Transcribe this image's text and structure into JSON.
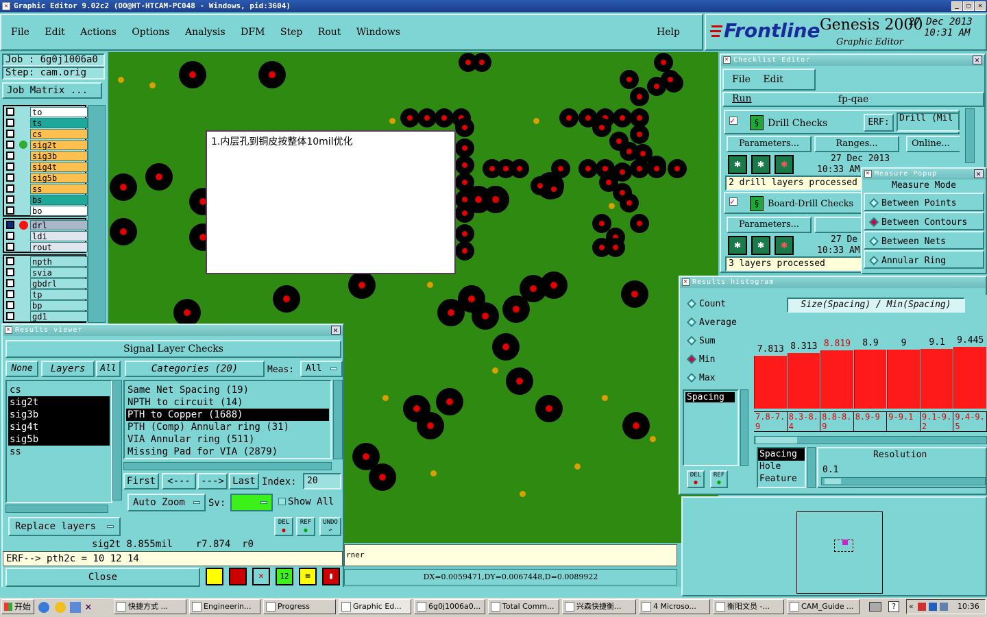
{
  "window": {
    "title": "Graphic Editor 9.02c2 (OO@HT-HTCAM-PC048 - Windows, pid:3604)"
  },
  "menu": [
    "File",
    "Edit",
    "Actions",
    "Options",
    "Analysis",
    "DFM",
    "Step",
    "Rout",
    "Windows"
  ],
  "help": "Help",
  "brand": {
    "logo": "Frontline",
    "product": "Genesis 2000",
    "subtitle": "Graphic Editor",
    "date": "27 Dec 2013",
    "time": "10:31 AM"
  },
  "job": {
    "job": "Job : 6g0j1006a0",
    "step": "Step: cam.orig",
    "matrix": "Job Matrix ..."
  },
  "layers_group1": [
    {
      "name": "to",
      "color": "#ffffff"
    },
    {
      "name": "ts",
      "color": "#1ea89a"
    },
    {
      "name": "cs",
      "color": "#ffc050"
    },
    {
      "name": "sig2t",
      "color": "#ffc050"
    },
    {
      "name": "sig3b",
      "color": "#ffc050"
    },
    {
      "name": "sig4t",
      "color": "#ffc050"
    },
    {
      "name": "sig5b",
      "color": "#ffc050"
    },
    {
      "name": "ss",
      "color": "#ffc050"
    },
    {
      "name": "bs",
      "color": "#1ea89a"
    },
    {
      "name": "bo",
      "color": "#ffffff"
    }
  ],
  "layers_group2": [
    {
      "name": "drl",
      "color": "#a8b8c8"
    },
    {
      "name": "ldi",
      "color": "#dfe6ee"
    },
    {
      "name": "rout",
      "color": "#dfe6ee"
    }
  ],
  "layers_group3": [
    {
      "name": "npth"
    },
    {
      "name": "svia"
    },
    {
      "name": "gbdrl"
    },
    {
      "name": "tp"
    },
    {
      "name": "bp"
    },
    {
      "name": "gd1"
    }
  ],
  "note": "1.内层孔到铜皮按整体10mil优化",
  "checklist": {
    "title": "Checklist Editor",
    "menu": [
      "File",
      "Edit",
      "Run"
    ],
    "name": "fp-qae",
    "drill_checks": "Drill Checks",
    "erf_label": "ERF:",
    "erf_value": "Drill (Mil",
    "parameters": "Parameters...",
    "ranges": "Ranges...",
    "online": "Online...",
    "drill_date": "27 Dec 2013",
    "drill_time": "10:33 AM",
    "drill_status": "2 drill layers processed",
    "board_checks": "Board-Drill Checks",
    "ranges2": "Rang",
    "board_date": "27 De",
    "board_time": "10:33 AM",
    "board_status": "3 layers processed"
  },
  "measure": {
    "title": "Measure Popup",
    "mode": "Measure Mode",
    "options": [
      "Between Points",
      "Between Contours",
      "Between Nets",
      "Annular Ring"
    ],
    "selected": 1
  },
  "results_viewer": {
    "title": "Results viewer",
    "header": "Signal Layer Checks",
    "none": "None",
    "layers": "Layers",
    "all": "All",
    "categories": "Categories (20)",
    "meas_label": "Meas:",
    "meas_value": "All",
    "layer_list": [
      "cs",
      "sig2t",
      "sig3b",
      "sig4t",
      "sig5b",
      "ss"
    ],
    "category_list": [
      "Same Net Spacing (19)",
      "NPTH to circuit (14)",
      "PTH to Copper (1688)",
      "PTH (Comp) Annular ring (31)",
      "VIA Annular ring (511)",
      "Missing Pad for VIA (2879)"
    ],
    "first": "First",
    "prev": "<---",
    "next": "--->",
    "last": "Last",
    "index_label": "Index:",
    "index_value": "20",
    "auto_zoom": "Auto Zoom",
    "sv_label": "Sv:",
    "show_all": "Show All",
    "replace_layers": "Replace layers",
    "del": "DEL",
    "ref": "REF",
    "undo": "UNDO"
  },
  "status": {
    "line1": "sig2t 8.855mil    r7.874  r0",
    "line2": "ERF--> pth2c = 10 12 14",
    "close": "Close",
    "corner": "rner",
    "dx": "DX=0.0059471,DY=0.0067448,D=0.0089922"
  },
  "histogram": {
    "title": "Results histogram",
    "modes": [
      "Count",
      "Average",
      "Sum",
      "Min",
      "Max"
    ],
    "selected_mode": 3,
    "list_item": "Spacing",
    "chart_title": "Size(Spacing) / Min(Spacing)",
    "tags": [
      "Spacing",
      "Hole",
      "Feature"
    ],
    "resolution_label": "Resolution",
    "resolution_value": "0.1",
    "del": "DEL",
    "ref": "REF"
  },
  "chart_data": {
    "type": "bar",
    "title": "Size(Spacing) / Min(Spacing)",
    "categories": [
      "7.8-7.9",
      "8.3-8.4",
      "8.8-8.9",
      "8.9-9",
      "9-9.1",
      "9.1-9.2",
      "9.4-9.5"
    ],
    "values": [
      7.813,
      8.313,
      8.819,
      8.9,
      9,
      9.1,
      9.445
    ],
    "value_labels": [
      "7.813",
      "8.313",
      "8.819",
      "8.9",
      "9",
      "9.1",
      "9.445"
    ],
    "highlight_index": 2,
    "bar_color": "#ff1a1a"
  },
  "taskbar": {
    "start": "开始",
    "items": [
      "快捷方式 ...",
      "Engineerin...",
      "Progress",
      "Graphic Ed...",
      "6g0j1006a0...",
      "Total Comm...",
      "兴森快捷衡...",
      "4 Microso...",
      "衡阳文员 -...",
      "CAM_Guide ..."
    ],
    "clock": "10:36"
  }
}
